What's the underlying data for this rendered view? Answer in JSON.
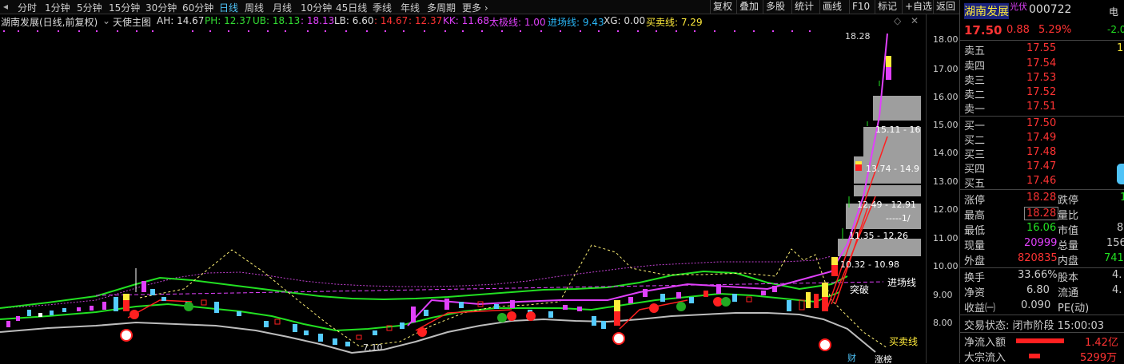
{
  "toolbar": {
    "timeframes": [
      "分时",
      "1分钟",
      "5分钟",
      "15分钟",
      "30分钟",
      "60分钟",
      "日线",
      "周线",
      "月线",
      "10分钟",
      "45日线",
      "季线",
      "年线",
      "多周期",
      "更多 ›"
    ],
    "active_timeframe": "日线",
    "right_buttons": [
      "复权",
      "叠加",
      "多股",
      "统计",
      "画线",
      "F10",
      "标记",
      "+自选",
      "返回"
    ]
  },
  "indicator_bar": {
    "stock_label": "湖南发展(日线,前复权)",
    "indicator_name": "天使主图",
    "AH": "AH: 14.67",
    "PH": "PH: 12.37",
    "UB": "UB: 18.13",
    "UB_sep": ": 18.13",
    "LB": "LB: 6.60",
    "LB2": ": 14.67",
    "LB3": ": 12.37",
    "KK": "KK: 11.68",
    "taiji": "太极线: 1.00",
    "jinchang": "进场线: 9.43",
    "XG": "XG: 0.00",
    "maimai": "买卖线: 7.29"
  },
  "chart_labels": {
    "high_marker": "18.28",
    "zone1": "15.11 - 16",
    "zone2": "13.74 - 14.9",
    "zone3": "12.49 - 12.91",
    "zone3b": "-----1/",
    "zone4": "11.35 - 12.26",
    "zone5": "10.32 - 10.98",
    "low_label": "7.10",
    "jinchang_label": "进场线",
    "maimai_label": "买卖线",
    "tupo": "突破",
    "zhangbang": "涨榜",
    "cai": "财"
  },
  "price_axis": [
    "18.00",
    "17.00",
    "16.00",
    "15.00",
    "14.00",
    "13.00",
    "12.00",
    "11.00",
    "10.00",
    "9.00",
    "8.00"
  ],
  "quote_panel": {
    "name": "湖南发展",
    "tag": "光伏",
    "code": "000722",
    "side_tag": "电",
    "side_value": "-2.0",
    "price": "17.50",
    "change": "0.88",
    "change_pct": "5.29%",
    "asks": [
      {
        "label": "卖五",
        "price": "17.55",
        "vol": "1"
      },
      {
        "label": "卖四",
        "price": "17.54",
        "vol": ""
      },
      {
        "label": "卖三",
        "price": "17.53",
        "vol": ""
      },
      {
        "label": "卖二",
        "price": "17.52",
        "vol": ""
      },
      {
        "label": "卖一",
        "price": "17.51",
        "vol": ""
      }
    ],
    "bids": [
      {
        "label": "买一",
        "price": "17.50",
        "vol": ""
      },
      {
        "label": "买二",
        "price": "17.49",
        "vol": ""
      },
      {
        "label": "买三",
        "price": "17.48",
        "vol": ""
      },
      {
        "label": "买四",
        "price": "17.47",
        "vol": ""
      },
      {
        "label": "买五",
        "price": "17.46",
        "vol": ""
      }
    ],
    "stats": [
      {
        "l1": "涨停",
        "v1": "18.28",
        "l2": "跌停",
        "v2": "1"
      },
      {
        "l1": "最高",
        "v1": "18.28",
        "l2": "量比",
        "v2": ""
      },
      {
        "l1": "最低",
        "v1": "16.06",
        "l2": "市值",
        "v2": "8"
      },
      {
        "l1": "现量",
        "v1": "20999",
        "l2": "总量",
        "v2": "156"
      },
      {
        "l1": "外盘",
        "v1": "820835",
        "l2": "内盘",
        "v2": "741"
      },
      {
        "l1": "换手",
        "v1": "33.66%",
        "l2": "股本",
        "v2": "4."
      },
      {
        "l1": "净资",
        "v1": "6.80",
        "l2": "流通",
        "v2": "4."
      },
      {
        "l1": "收益㈠",
        "v1": "0.090",
        "l2": "PE(动)",
        "v2": ""
      }
    ],
    "trade_status": "交易状态: 闭市阶段 15:00:03",
    "net_inflow_label": "净流入额",
    "net_inflow": "1.42亿",
    "block_inflow_label": "大宗流入",
    "block_inflow": "5299万"
  }
}
